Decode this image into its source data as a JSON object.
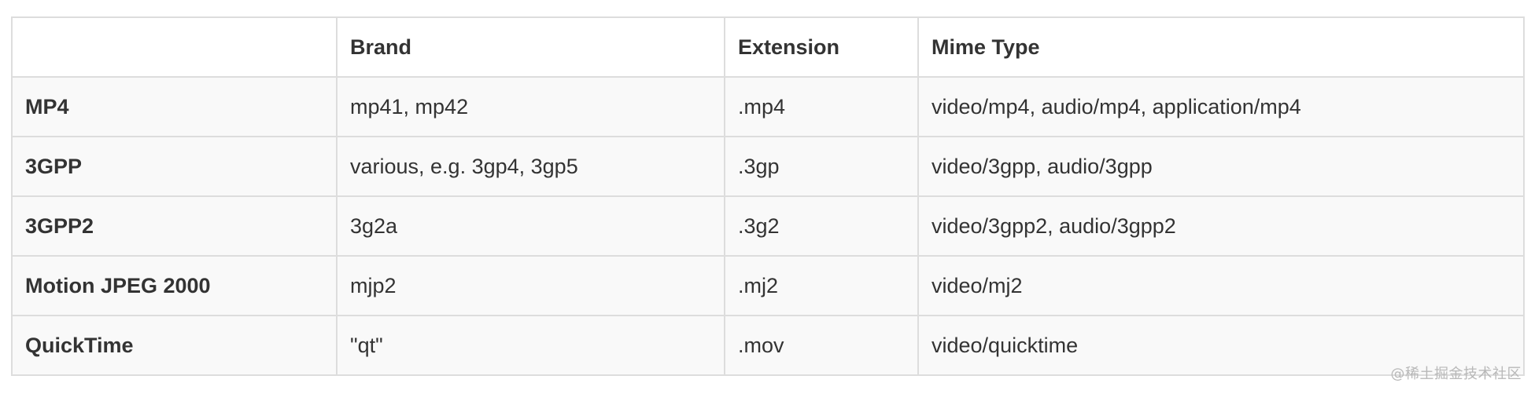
{
  "table": {
    "headers": [
      "",
      "Brand",
      "Extension",
      "Mime Type"
    ],
    "rows": [
      [
        "MP4",
        "mp41, mp42",
        ".mp4",
        "video/mp4, audio/mp4, application/mp4"
      ],
      [
        "3GPP",
        "various, e.g. 3gp4, 3gp5",
        ".3gp",
        "video/3gpp, audio/3gpp"
      ],
      [
        "3GPP2",
        "3g2a",
        ".3g2",
        "video/3gpp2, audio/3gpp2"
      ],
      [
        "Motion JPEG 2000",
        "mjp2",
        ".mj2",
        "video/mj2"
      ],
      [
        "QuickTime",
        "\"qt\"",
        ".mov",
        "video/quicktime"
      ]
    ]
  },
  "watermark": "@稀土掘金技术社区"
}
